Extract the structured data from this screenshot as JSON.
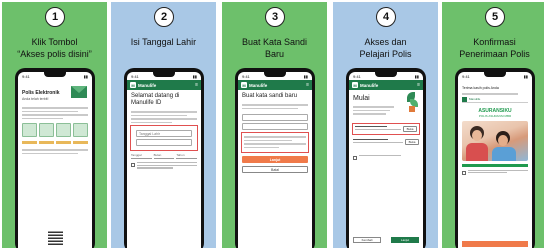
{
  "steps": [
    {
      "number": "1",
      "title_line1": "Klik Tombol",
      "title_line2": "“Akses polis disini”",
      "screen": {
        "time": "9:41",
        "heading": "Polis Elektronik",
        "subheading": "Anda telah terbit!"
      }
    },
    {
      "number": "2",
      "title_line1": "Isi Tanggal Lahir",
      "title_line2": "",
      "screen": {
        "time": "9:41",
        "brand": "Manulife",
        "menu": "≡",
        "heading": "Selamat datang di Manulife ID",
        "field_label": "Tanggal Lahir",
        "dropdown_1": "Tanggal",
        "dropdown_2": "Bulan",
        "dropdown_3": "Tahun"
      }
    },
    {
      "number": "3",
      "title_line1": "Buat Kata Sandi",
      "title_line2": "Baru",
      "screen": {
        "time": "9:41",
        "brand": "Manulife",
        "menu": "≡",
        "heading": "Buat kata sandi baru",
        "submit_label": "Lanjut",
        "back_label": "Batal"
      }
    },
    {
      "number": "4",
      "title_line1": "Akses dan",
      "title_line2": "Pelajari Polis",
      "screen": {
        "time": "9:41",
        "brand": "Manulife",
        "menu": "≡",
        "heading": "Mulai",
        "policy_button_1": "Buka",
        "policy_button_2": "Buka",
        "back_label": "Kembali",
        "next_label": "Lanjut"
      }
    },
    {
      "number": "5",
      "title_line1": "Konfirmasi",
      "title_line2": "Penerimaan Polis",
      "screen": {
        "time": "9:41",
        "heading": "Terima kasih polis Anda",
        "brand": "Manulife",
        "product": "ASURANSIKU",
        "product_sub": "POLIS ASURANSI MBR"
      }
    }
  ],
  "colors": {
    "green_panel": "#6dc06b",
    "blue_panel": "#a9c8e6",
    "manulife_green": "#1f7a4a",
    "accent_orange": "#f07a4a",
    "highlight_red": "#e05050"
  }
}
